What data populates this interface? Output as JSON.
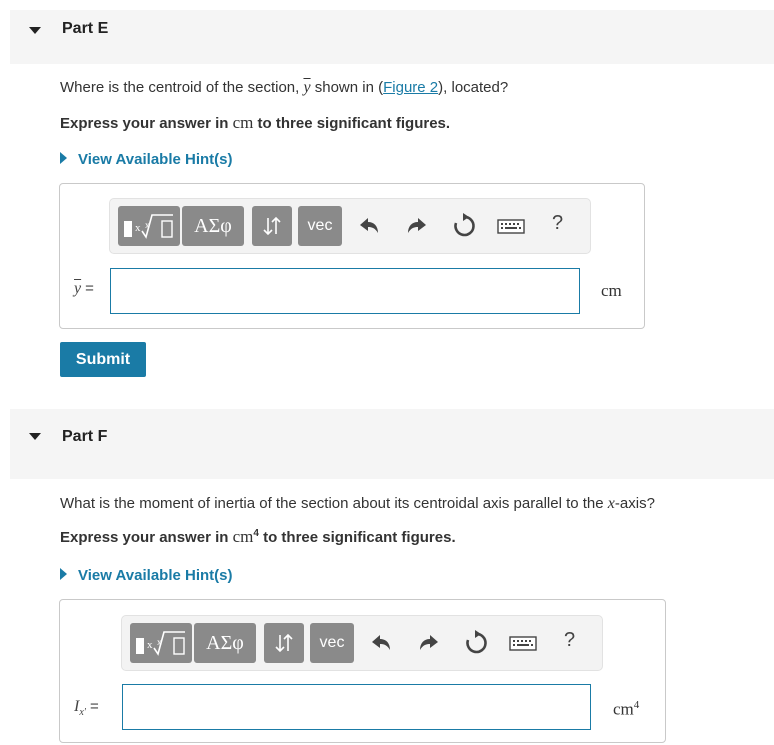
{
  "partE": {
    "title": "Part E",
    "question_prefix": "Where is the centroid of the section, ",
    "question_var": "y",
    "question_mid": " shown in (",
    "figure_link": "Figure 2",
    "question_suffix": "), located?",
    "instr_prefix": "Express your answer in ",
    "instr_unit": "cm",
    "instr_suffix": " to three significant figures.",
    "hint_label": "View Available Hint(s)",
    "var_label": "y",
    "eq": "=",
    "input_value": "",
    "unit": "cm",
    "submit_label": "Submit"
  },
  "partF": {
    "title": "Part F",
    "question_prefix": "What is the moment of inertia of the section about its centroidal axis parallel to the ",
    "question_var": "x",
    "question_suffix": "-axis?",
    "instr_prefix": "Express your answer in ",
    "instr_unit": "cm",
    "instr_unit_exp": "4",
    "instr_suffix": " to three significant figures.",
    "hint_label": "View Available Hint(s)",
    "var_label": "I",
    "var_sub": "x′",
    "eq": "=",
    "input_value": "",
    "unit": "cm",
    "unit_exp": "4"
  },
  "toolbar": {
    "greek_label": "ΑΣφ",
    "vec_label": "vec",
    "help_label": "?",
    "icons": [
      "templates-icon",
      "greek-letters",
      "subscript-superscript-icon",
      "vec",
      "undo-icon",
      "redo-icon",
      "reset-icon",
      "keyboard-icon",
      "help"
    ]
  },
  "colors": {
    "accent": "#1a7ba6",
    "toolbar_button": "#8a8a8a",
    "header_bg": "#f5f5f5"
  }
}
